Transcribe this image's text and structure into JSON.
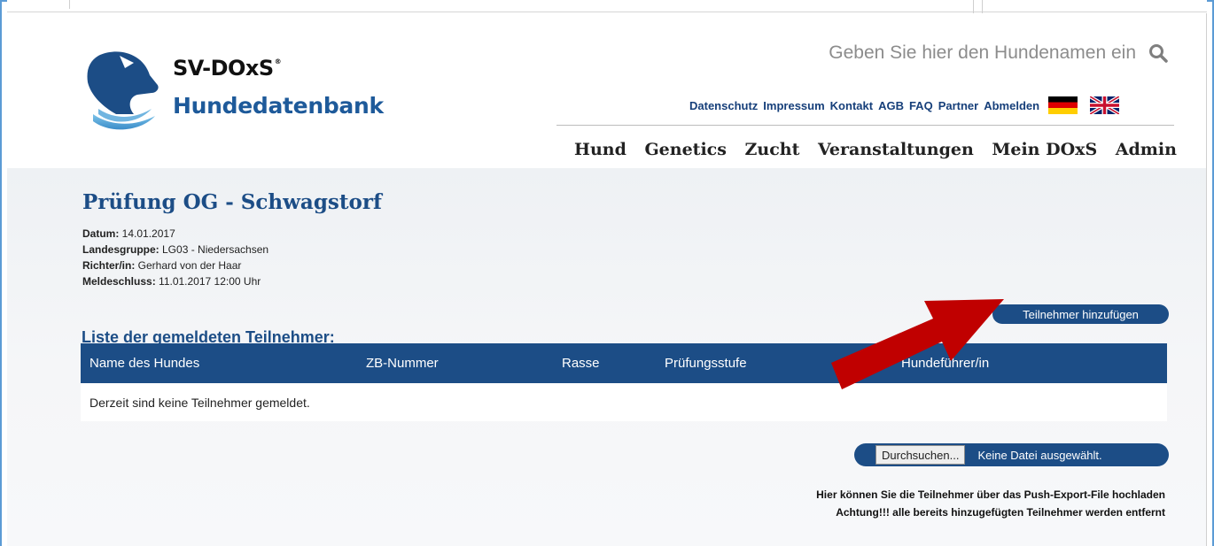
{
  "header": {
    "brand_line1": "SV-DOxS",
    "brand_reg": "®",
    "brand_line2": "Hundedatenbank",
    "search_placeholder": "Geben Sie hier den Hundenamen ein",
    "search_icon": "search-icon"
  },
  "toplinks": [
    "Datenschutz",
    "Impressum",
    "Kontakt",
    "AGB",
    "FAQ",
    "Partner",
    "Abmelden"
  ],
  "flags": [
    "flag-germany-icon",
    "flag-uk-icon"
  ],
  "mainnav": [
    "Hund",
    "Genetics",
    "Zucht",
    "Veranstaltungen",
    "Mein DOxS",
    "Admin"
  ],
  "event": {
    "title": "Prüfung OG - Schwagstorf",
    "datum_label": "Datum:",
    "datum_value": " 14.01.2017",
    "landesgruppe_label": "Landesgruppe:",
    "landesgruppe_value": " LG03 - Niedersachsen",
    "richter_label": "Richter/in:",
    "richter_value": " Gerhard von der Haar",
    "meldeschluss_label": "Meldeschluss:",
    "meldeschluss_value": " 11.01.2017 12:00 Uhr"
  },
  "participants": {
    "title": "Liste der gemeldeten Teilnehmer:",
    "add_button": "Teilnehmer hinzufügen",
    "columns": [
      "Name des Hundes",
      "ZB-Nummer",
      "Rasse",
      "Prüfungsstufe",
      "Hundeführer/in"
    ],
    "empty_text": "Derzeit sind keine Teilnehmer gemeldet."
  },
  "upload": {
    "browse_label": "Durchsuchen...",
    "file_status": "Keine Datei ausgewählt.",
    "note_line1": "Hier können Sie die Teilnehmer über das Push-Export-File hochladen",
    "note_line2": "Achtung!!! alle bereits hinzugefügten Teilnehmer werden entfernt"
  },
  "colors": {
    "primary": "#1c4d86",
    "annotation_arrow": "#c00000"
  }
}
